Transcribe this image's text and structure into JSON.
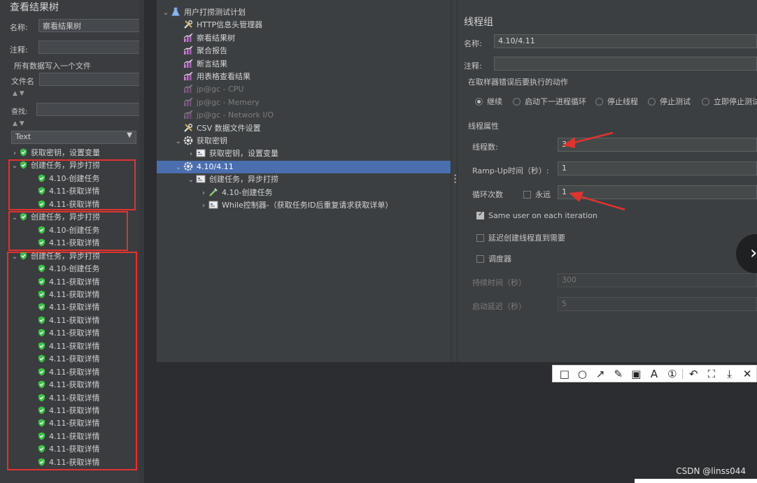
{
  "left_panel": {
    "title": "查看结果树",
    "name_label": "名称:",
    "name_value": "察看结果树",
    "comment_label": "注释:",
    "all_data_label": "所有数据写入一个文件",
    "filename_label": "文件名",
    "search_label": "查找:",
    "renderer_value": "Text",
    "tree": [
      {
        "label": "获取密钥，设置变量",
        "level": 0,
        "chevron": "›"
      },
      {
        "label": "创建任务，异步打捞",
        "level": 0,
        "chevron": "⌄"
      },
      {
        "label": "4.10-创建任务",
        "level": 1,
        "chevron": ""
      },
      {
        "label": "4.11-获取详情",
        "level": 1,
        "chevron": ""
      },
      {
        "label": "4.11-获取详情",
        "level": 1,
        "chevron": ""
      },
      {
        "label": "创建任务，异步打捞",
        "level": 0,
        "chevron": "⌄"
      },
      {
        "label": "4.10-创建任务",
        "level": 1,
        "chevron": ""
      },
      {
        "label": "4.11-获取详情",
        "level": 1,
        "chevron": ""
      },
      {
        "label": "创建任务，异步打捞",
        "level": 0,
        "chevron": "⌄"
      },
      {
        "label": "4.10-创建任务",
        "level": 1,
        "chevron": ""
      },
      {
        "label": "4.11-获取详情",
        "level": 1,
        "chevron": ""
      },
      {
        "label": "4.11-获取详情",
        "level": 1,
        "chevron": ""
      },
      {
        "label": "4.11-获取详情",
        "level": 1,
        "chevron": ""
      },
      {
        "label": "4.11-获取详情",
        "level": 1,
        "chevron": ""
      },
      {
        "label": "4.11-获取详情",
        "level": 1,
        "chevron": ""
      },
      {
        "label": "4.11-获取详情",
        "level": 1,
        "chevron": ""
      },
      {
        "label": "4.11-获取详情",
        "level": 1,
        "chevron": ""
      },
      {
        "label": "4.11-获取详情",
        "level": 1,
        "chevron": ""
      },
      {
        "label": "4.11-获取详情",
        "level": 1,
        "chevron": ""
      },
      {
        "label": "4.11-获取详情",
        "level": 1,
        "chevron": ""
      },
      {
        "label": "4.11-获取详情",
        "level": 1,
        "chevron": ""
      },
      {
        "label": "4.11-获取详情",
        "level": 1,
        "chevron": ""
      },
      {
        "label": "4.11-获取详情",
        "level": 1,
        "chevron": ""
      },
      {
        "label": "4.11-获取详情",
        "level": 1,
        "chevron": ""
      },
      {
        "label": "4.11-获取详情",
        "level": 1,
        "chevron": ""
      }
    ]
  },
  "test_tree": [
    {
      "label": "用户打捞测试计划",
      "level": 0,
      "chevron": "⌄",
      "icon": "flask-icon",
      "dim": false
    },
    {
      "label": "HTTP信息头管理器",
      "level": 1,
      "chevron": "",
      "icon": "wrench-icon",
      "dim": false
    },
    {
      "label": "察看结果树",
      "level": 1,
      "chevron": "",
      "icon": "graph-icon",
      "dim": false
    },
    {
      "label": "聚合报告",
      "level": 1,
      "chevron": "",
      "icon": "graph-icon",
      "dim": false
    },
    {
      "label": "断言结果",
      "level": 1,
      "chevron": "",
      "icon": "graph-icon",
      "dim": false
    },
    {
      "label": "用表格查看结果",
      "level": 1,
      "chevron": "",
      "icon": "graph-icon",
      "dim": false
    },
    {
      "label": "jp@gc - CPU",
      "level": 1,
      "chevron": "",
      "icon": "graph-icon",
      "dim": true
    },
    {
      "label": "jp@gc - Memery",
      "level": 1,
      "chevron": "",
      "icon": "graph-icon",
      "dim": true
    },
    {
      "label": "jp@gc - Network I/O",
      "level": 1,
      "chevron": "",
      "icon": "graph-icon",
      "dim": true
    },
    {
      "label": "CSV 数据文件设置",
      "level": 1,
      "chevron": "",
      "icon": "wrench-icon",
      "dim": false
    },
    {
      "label": "获取密钥",
      "level": 1,
      "chevron": "⌄",
      "icon": "gear-icon",
      "dim": false
    },
    {
      "label": "获取密钥，设置变量",
      "level": 2,
      "chevron": "›",
      "icon": "controller-icon",
      "dim": false
    },
    {
      "label": "4.10/4.11",
      "level": 1,
      "chevron": "⌄",
      "icon": "gear-icon",
      "dim": false,
      "selected": true
    },
    {
      "label": "创建任务，异步打捞",
      "level": 2,
      "chevron": "⌄",
      "icon": "controller-icon",
      "dim": false
    },
    {
      "label": "4.10-创建任务",
      "level": 3,
      "chevron": "›",
      "icon": "pipette-icon",
      "dim": false
    },
    {
      "label": "While控制器-（获取任务ID后重复请求获取详单）",
      "level": 3,
      "chevron": "›",
      "icon": "controller-icon",
      "dim": false
    }
  ],
  "thread_group": {
    "title": "线程组",
    "name_label": "名称:",
    "name_value": "4.10/4.11",
    "comment_label": "注释:",
    "error_action_label": "在取样器错误后要执行的动作",
    "error_actions": [
      "继续",
      "启动下一进程循环",
      "停止线程",
      "停止测试",
      "立即停止测试"
    ],
    "thread_props_label": "线程属性",
    "threads_label": "线程数:",
    "threads_value": "3",
    "rampup_label": "Ramp-Up时间（秒）:",
    "rampup_value": "1",
    "loop_label": "循环次数",
    "forever_label": "永远",
    "loop_value": "1",
    "same_user_label": "Same user on each iteration",
    "delay_label": "延迟创建线程直到需要",
    "scheduler_label": "调度器",
    "duration_label": "持续时间（秒）",
    "duration_value": "300",
    "startup_delay_label": "启动延迟（秒）",
    "startup_delay_value": "5"
  },
  "watermark": "CSDN @linss044",
  "colors": {
    "accent_red": "#e0332f",
    "selection": "#4b6eaf",
    "shield_green": "#3fbf4a"
  }
}
